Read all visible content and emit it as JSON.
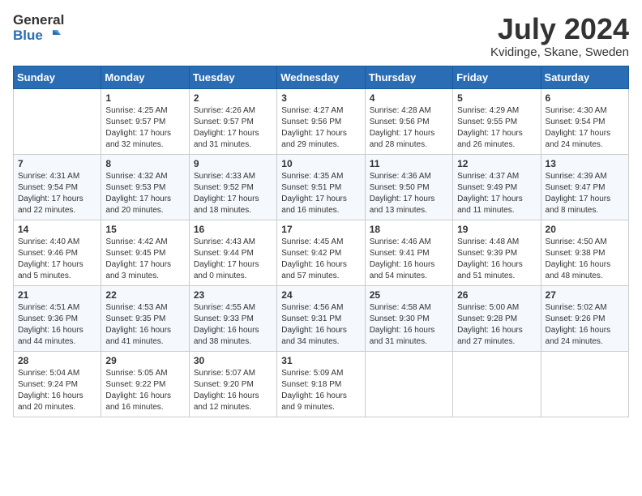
{
  "logo": {
    "line1": "General",
    "line2": "Blue"
  },
  "title": {
    "month_year": "July 2024",
    "location": "Kvidinge, Skane, Sweden"
  },
  "headers": [
    "Sunday",
    "Monday",
    "Tuesday",
    "Wednesday",
    "Thursday",
    "Friday",
    "Saturday"
  ],
  "weeks": [
    [
      {
        "day": "",
        "info": ""
      },
      {
        "day": "1",
        "info": "Sunrise: 4:25 AM\nSunset: 9:57 PM\nDaylight: 17 hours and 32 minutes."
      },
      {
        "day": "2",
        "info": "Sunrise: 4:26 AM\nSunset: 9:57 PM\nDaylight: 17 hours and 31 minutes."
      },
      {
        "day": "3",
        "info": "Sunrise: 4:27 AM\nSunset: 9:56 PM\nDaylight: 17 hours and 29 minutes."
      },
      {
        "day": "4",
        "info": "Sunrise: 4:28 AM\nSunset: 9:56 PM\nDaylight: 17 hours and 28 minutes."
      },
      {
        "day": "5",
        "info": "Sunrise: 4:29 AM\nSunset: 9:55 PM\nDaylight: 17 hours and 26 minutes."
      },
      {
        "day": "6",
        "info": "Sunrise: 4:30 AM\nSunset: 9:54 PM\nDaylight: 17 hours and 24 minutes."
      }
    ],
    [
      {
        "day": "7",
        "info": "Sunrise: 4:31 AM\nSunset: 9:54 PM\nDaylight: 17 hours and 22 minutes."
      },
      {
        "day": "8",
        "info": "Sunrise: 4:32 AM\nSunset: 9:53 PM\nDaylight: 17 hours and 20 minutes."
      },
      {
        "day": "9",
        "info": "Sunrise: 4:33 AM\nSunset: 9:52 PM\nDaylight: 17 hours and 18 minutes."
      },
      {
        "day": "10",
        "info": "Sunrise: 4:35 AM\nSunset: 9:51 PM\nDaylight: 17 hours and 16 minutes."
      },
      {
        "day": "11",
        "info": "Sunrise: 4:36 AM\nSunset: 9:50 PM\nDaylight: 17 hours and 13 minutes."
      },
      {
        "day": "12",
        "info": "Sunrise: 4:37 AM\nSunset: 9:49 PM\nDaylight: 17 hours and 11 minutes."
      },
      {
        "day": "13",
        "info": "Sunrise: 4:39 AM\nSunset: 9:47 PM\nDaylight: 17 hours and 8 minutes."
      }
    ],
    [
      {
        "day": "14",
        "info": "Sunrise: 4:40 AM\nSunset: 9:46 PM\nDaylight: 17 hours and 5 minutes."
      },
      {
        "day": "15",
        "info": "Sunrise: 4:42 AM\nSunset: 9:45 PM\nDaylight: 17 hours and 3 minutes."
      },
      {
        "day": "16",
        "info": "Sunrise: 4:43 AM\nSunset: 9:44 PM\nDaylight: 17 hours and 0 minutes."
      },
      {
        "day": "17",
        "info": "Sunrise: 4:45 AM\nSunset: 9:42 PM\nDaylight: 16 hours and 57 minutes."
      },
      {
        "day": "18",
        "info": "Sunrise: 4:46 AM\nSunset: 9:41 PM\nDaylight: 16 hours and 54 minutes."
      },
      {
        "day": "19",
        "info": "Sunrise: 4:48 AM\nSunset: 9:39 PM\nDaylight: 16 hours and 51 minutes."
      },
      {
        "day": "20",
        "info": "Sunrise: 4:50 AM\nSunset: 9:38 PM\nDaylight: 16 hours and 48 minutes."
      }
    ],
    [
      {
        "day": "21",
        "info": "Sunrise: 4:51 AM\nSunset: 9:36 PM\nDaylight: 16 hours and 44 minutes."
      },
      {
        "day": "22",
        "info": "Sunrise: 4:53 AM\nSunset: 9:35 PM\nDaylight: 16 hours and 41 minutes."
      },
      {
        "day": "23",
        "info": "Sunrise: 4:55 AM\nSunset: 9:33 PM\nDaylight: 16 hours and 38 minutes."
      },
      {
        "day": "24",
        "info": "Sunrise: 4:56 AM\nSunset: 9:31 PM\nDaylight: 16 hours and 34 minutes."
      },
      {
        "day": "25",
        "info": "Sunrise: 4:58 AM\nSunset: 9:30 PM\nDaylight: 16 hours and 31 minutes."
      },
      {
        "day": "26",
        "info": "Sunrise: 5:00 AM\nSunset: 9:28 PM\nDaylight: 16 hours and 27 minutes."
      },
      {
        "day": "27",
        "info": "Sunrise: 5:02 AM\nSunset: 9:26 PM\nDaylight: 16 hours and 24 minutes."
      }
    ],
    [
      {
        "day": "28",
        "info": "Sunrise: 5:04 AM\nSunset: 9:24 PM\nDaylight: 16 hours and 20 minutes."
      },
      {
        "day": "29",
        "info": "Sunrise: 5:05 AM\nSunset: 9:22 PM\nDaylight: 16 hours and 16 minutes."
      },
      {
        "day": "30",
        "info": "Sunrise: 5:07 AM\nSunset: 9:20 PM\nDaylight: 16 hours and 12 minutes."
      },
      {
        "day": "31",
        "info": "Sunrise: 5:09 AM\nSunset: 9:18 PM\nDaylight: 16 hours and 9 minutes."
      },
      {
        "day": "",
        "info": ""
      },
      {
        "day": "",
        "info": ""
      },
      {
        "day": "",
        "info": ""
      }
    ]
  ]
}
